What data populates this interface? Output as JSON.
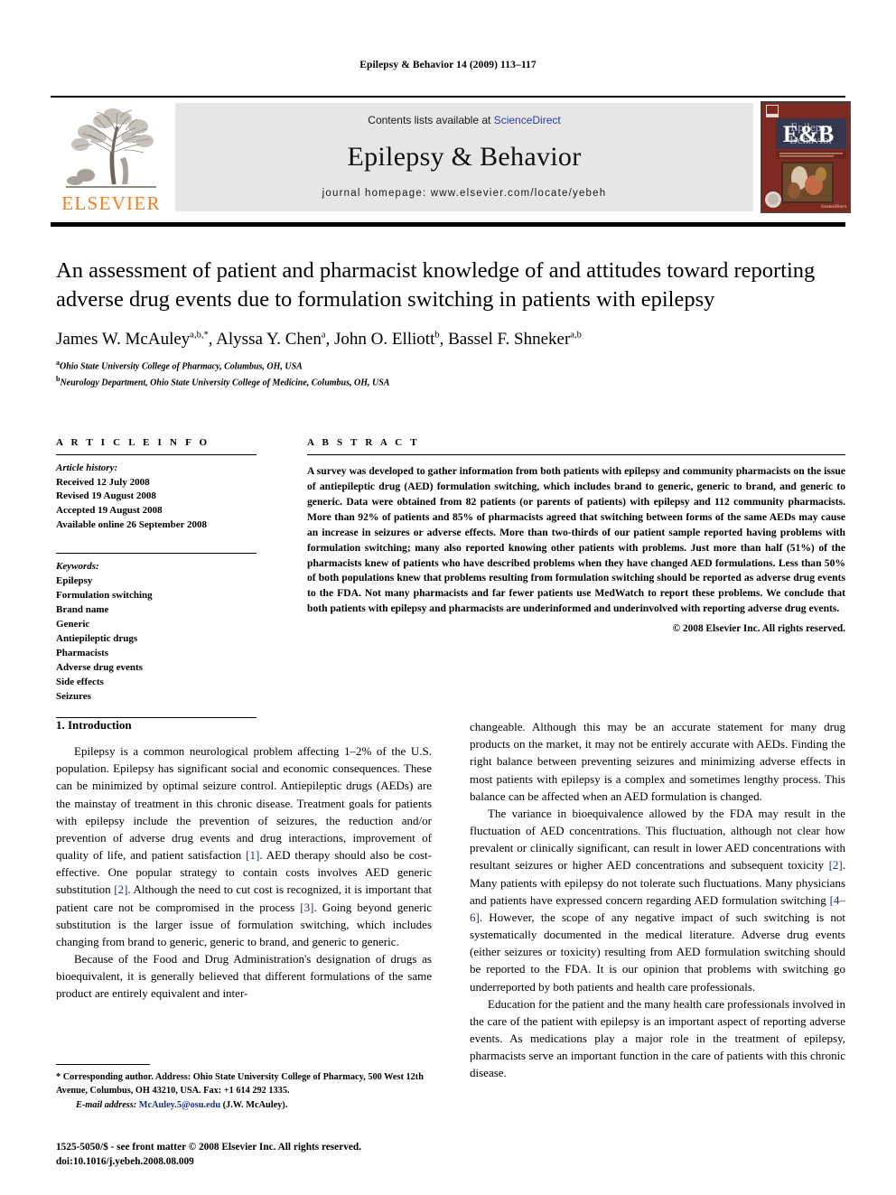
{
  "running_head": "Epilepsy & Behavior 14 (2009) 113–117",
  "masthead": {
    "publisher_name": "ELSEVIER",
    "contents_prefix": "Contents lists available at ",
    "contents_link": "ScienceDirect",
    "journal_name": "Epilepsy & Behavior",
    "homepage": "journal homepage: www.elsevier.com/locate/yebeh",
    "cover_title_line1": "Epilepsy",
    "cover_title_line2": "&",
    "cover_title_line3": "Behavior",
    "cover_badge": "E&B"
  },
  "article": {
    "title": "An assessment of patient and pharmacist knowledge of and attitudes toward reporting adverse drug events due to formulation switching in patients with epilepsy",
    "authors_html": "James W. McAuley<sup>a,b,*</sup>, Alyssa Y. Chen<sup>a</sup>, John O. Elliott<sup>b</sup>, Bassel F. Shneker<sup>a,b</sup>",
    "affiliations": [
      {
        "marker": "a",
        "text": "Ohio State University College of Pharmacy, Columbus, OH, USA"
      },
      {
        "marker": "b",
        "text": "Neurology Department, Ohio State University College of Medicine, Columbus, OH, USA"
      }
    ]
  },
  "info": {
    "label": "A R T I C L E   I N F O",
    "history_title": "Article history:",
    "history": [
      "Received 12 July 2008",
      "Revised 19 August 2008",
      "Accepted 19 August 2008",
      "Available online 26 September 2008"
    ],
    "keywords_title": "Keywords:",
    "keywords": [
      "Epilepsy",
      "Formulation switching",
      "Brand name",
      "Generic",
      "Antiepileptic drugs",
      "Pharmacists",
      "Adverse drug events",
      "Side effects",
      "Seizures"
    ]
  },
  "abstract": {
    "label": "A B S T R A C T",
    "text": "A survey was developed to gather information from both patients with epilepsy and community pharmacists on the issue of antiepileptic drug (AED) formulation switching, which includes brand to generic, generic to brand, and generic to generic. Data were obtained from 82 patients (or parents of patients) with epilepsy and 112 community pharmacists. More than 92% of patients and 85% of pharmacists agreed that switching between forms of the same AEDs may cause an increase in seizures or adverse effects. More than two-thirds of our patient sample reported having problems with formulation switching; many also reported knowing other patients with problems. Just more than half (51%) of the pharmacists knew of patients who have described problems when they have changed AED formulations. Less than 50% of both populations knew that problems resulting from formulation switching should be reported as adverse drug events to the FDA. Not many pharmacists and far fewer patients use MedWatch to report these problems. We conclude that both patients with epilepsy and pharmacists are underinformed and underinvolved with reporting adverse drug events.",
    "copyright": "© 2008 Elsevier Inc. All rights reserved."
  },
  "body": {
    "section_heading": "1. Introduction",
    "left_paragraphs": [
      "Epilepsy is a common neurological problem affecting 1–2% of the U.S. population. Epilepsy has significant social and economic consequences. These can be minimized by optimal seizure control. Antiepileptic drugs (AEDs) are the mainstay of treatment in this chronic disease. Treatment goals for patients with epilepsy include the prevention of seizures, the reduction and/or prevention of adverse drug events and drug interactions, improvement of quality of life, and patient satisfaction [1]. AED therapy should also be cost-effective. One popular strategy to contain costs involves AED generic substitution [2]. Although the need to cut cost is recognized, it is important that patient care not be compromised in the process [3]. Going beyond generic substitution is the larger issue of formulation switching, which includes changing from brand to generic, generic to brand, and generic to generic.",
      "Because of the Food and Drug Administration's designation of drugs as bioequivalent, it is generally believed that different formulations of the same product are entirely equivalent and inter-"
    ],
    "right_paragraphs": [
      "changeable. Although this may be an accurate statement for many drug products on the market, it may not be entirely accurate with AEDs. Finding the right balance between preventing seizures and minimizing adverse effects in most patients with epilepsy is a complex and sometimes lengthy process. This balance can be affected when an AED formulation is changed.",
      "The variance in bioequivalence allowed by the FDA may result in the fluctuation of AED concentrations. This fluctuation, although not clear how prevalent or clinically significant, can result in lower AED concentrations with resultant seizures or higher AED concentrations and subsequent toxicity [2]. Many patients with epilepsy do not tolerate such fluctuations. Many physicians and patients have expressed concern regarding AED formulation switching [4–6]. However, the scope of any negative impact of such switching is not systematically documented in the medical literature. Adverse drug events (either seizures or toxicity) resulting from AED formulation switching should be reported to the FDA. It is our opinion that problems with switching go underreported by both patients and health care professionals.",
      "Education for the patient and the many health care professionals involved in the care of the patient with epilepsy is an important aspect of reporting adverse events. As medications play a major role in the treatment of epilepsy, pharmacists serve an important function in the care of patients with this chronic disease."
    ]
  },
  "footnote": {
    "corresponding": "* Corresponding author. Address: Ohio State University College of Pharmacy, 500 West 12th Avenue, Columbus, OH 43210, USA. Fax: +1 614 292 1335.",
    "email_label": "E-mail address:",
    "email": "McAuley.5@osu.edu",
    "email_suffix": "(J.W. McAuley)."
  },
  "page_footer": {
    "issn_line": "1525-5050/$ - see front matter © 2008 Elsevier Inc. All rights reserved.",
    "doi_line": "doi:10.1016/j.yebeh.2008.08.009"
  },
  "colors": {
    "elsevier_orange": "#ef7d22",
    "link_blue": "#2b3f9e",
    "reference_blue": "#1a2e8c",
    "cover_maroon": "#7d2b22",
    "band_gray": "#e6e6e6"
  }
}
